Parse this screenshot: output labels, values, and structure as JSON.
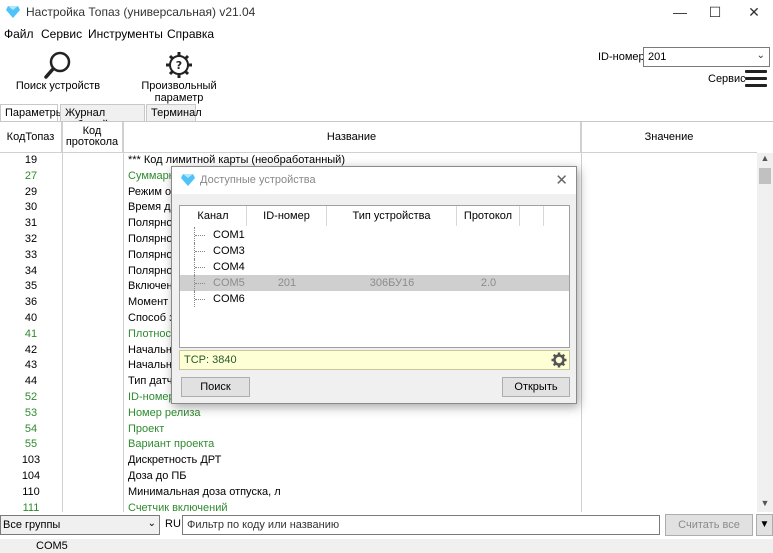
{
  "window": {
    "title": "Настройка Топаз (универсальная) v21.04"
  },
  "menu": [
    "Файл",
    "Сервис",
    "Инструменты",
    "Справка"
  ],
  "toolbar": {
    "search_label": "Поиск устройств",
    "custom_param_label": "Произвольный параметр",
    "id_label": "ID-номер",
    "id_value": "201",
    "service_label": "Сервис"
  },
  "tabs": [
    "Параметры",
    "Журнал событий",
    "Терминал"
  ],
  "grid": {
    "headers": {
      "code": "КодТопаз",
      "proto": "Код протокола",
      "name": "Название",
      "value": "Значение"
    },
    "rows": [
      {
        "code": "19",
        "name": "*** Код лимитной карты (необработанный)",
        "green": false
      },
      {
        "code": "27",
        "name": "Суммарны",
        "green": true
      },
      {
        "code": "29",
        "name": "Режим отс",
        "green": false
      },
      {
        "code": "30",
        "name": "Время до в",
        "green": false
      },
      {
        "code": "31",
        "name": "Полярност",
        "green": false
      },
      {
        "code": "32",
        "name": "Полярност",
        "green": false
      },
      {
        "code": "33",
        "name": "Полярност",
        "green": false
      },
      {
        "code": "34",
        "name": "Полярност",
        "green": false
      },
      {
        "code": "35",
        "name": "Включени",
        "green": false
      },
      {
        "code": "36",
        "name": "Момент за",
        "green": false
      },
      {
        "code": "40",
        "name": "Способ за",
        "green": false
      },
      {
        "code": "41",
        "name": "Плотность",
        "green": true
      },
      {
        "code": "42",
        "name": "Начальная",
        "green": false
      },
      {
        "code": "43",
        "name": "Начальная",
        "green": false
      },
      {
        "code": "44",
        "name": "Тип датчи",
        "green": false
      },
      {
        "code": "52",
        "name": "ID-номер",
        "green": true
      },
      {
        "code": "53",
        "name": "Номер релиза",
        "green": true
      },
      {
        "code": "54",
        "name": "Проект",
        "green": true
      },
      {
        "code": "55",
        "name": "Вариант проекта",
        "green": true
      },
      {
        "code": "103",
        "name": "Дискретность ДРТ",
        "green": false
      },
      {
        "code": "104",
        "name": "Доза до ПБ",
        "green": false
      },
      {
        "code": "110",
        "name": "Минимальная доза отпуска, л",
        "green": false
      },
      {
        "code": "111",
        "name": "Счетчик включений",
        "green": true
      }
    ]
  },
  "bottom": {
    "groups_value": "Все группы",
    "lang": "RU",
    "filter_placeholder": "Фильтр по коду или названию",
    "read_all_label": "Считать все"
  },
  "status": {
    "port": "COM5"
  },
  "dialog": {
    "title": "Доступные устройства",
    "headers": {
      "channel": "Канал",
      "id": "ID-номер",
      "type": "Тип устройства",
      "protocol": "Протокол"
    },
    "devices": [
      {
        "channel": "COM1",
        "id": "",
        "type": "",
        "protocol": "",
        "selected": false
      },
      {
        "channel": "COM3",
        "id": "",
        "type": "",
        "protocol": "",
        "selected": false
      },
      {
        "channel": "COM4",
        "id": "",
        "type": "",
        "protocol": "",
        "selected": false
      },
      {
        "channel": "COM5",
        "id": "201",
        "type": "306БУ16",
        "protocol": "2.0",
        "selected": true
      },
      {
        "channel": "COM6",
        "id": "",
        "type": "",
        "protocol": "",
        "selected": false
      }
    ],
    "tcp_label": "TCP: 3840",
    "search_button": "Поиск",
    "open_button": "Открыть"
  },
  "colors": {
    "green_text": "#2e8b2e",
    "tcp_bg": "#ffffd6",
    "selected_row": "#cfcfcf"
  }
}
